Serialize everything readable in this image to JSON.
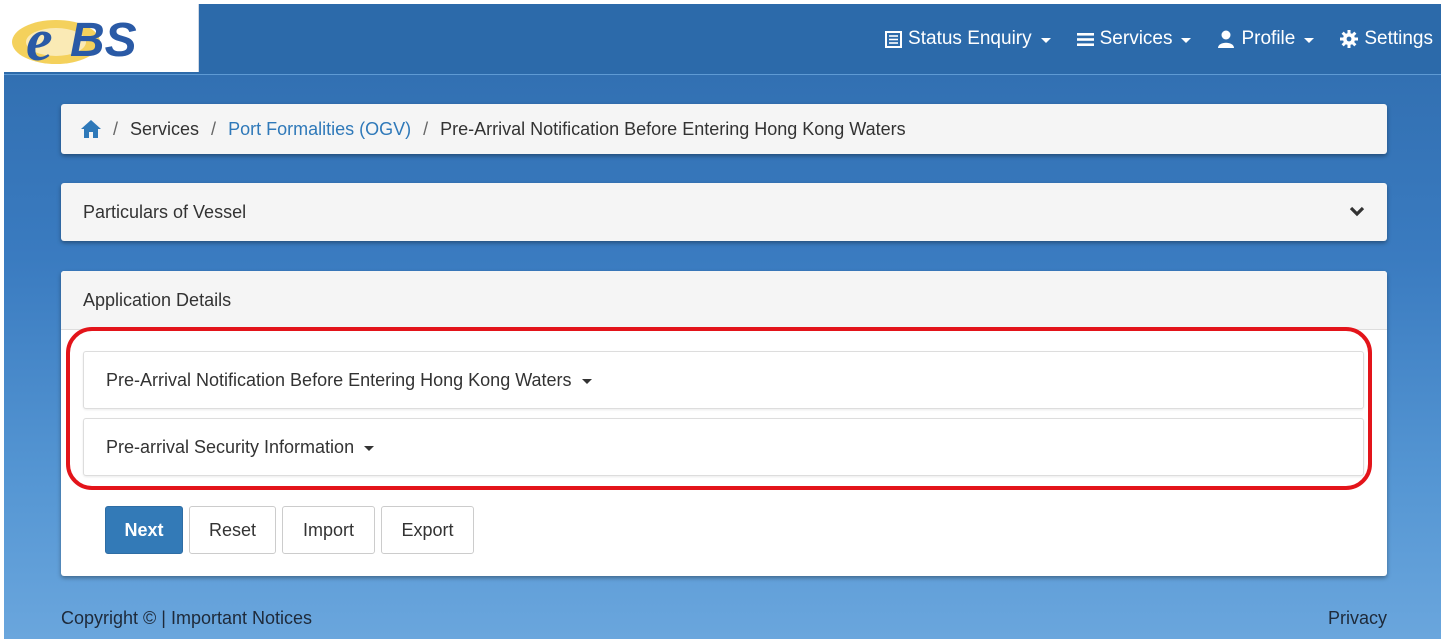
{
  "logo": {
    "text": "eBS"
  },
  "nav": {
    "status_enquiry": "Status Enquiry",
    "services": "Services",
    "profile": "Profile",
    "settings": "Settings"
  },
  "breadcrumb": {
    "services": "Services",
    "port_formalities": "Port Formalities (OGV)",
    "current": "Pre-Arrival Notification Before Entering Hong Kong Waters",
    "separator": "/"
  },
  "particulars": {
    "title": "Particulars of Vessel"
  },
  "application": {
    "title": "Application Details",
    "sections": [
      {
        "label": "Pre-Arrival Notification Before Entering Hong Kong Waters"
      },
      {
        "label": "Pre-arrival Security Information"
      }
    ]
  },
  "buttons": {
    "next": "Next",
    "reset": "Reset",
    "import": "Import",
    "export": "Export"
  },
  "footer": {
    "copyright": "Copyright © | Important Notices",
    "privacy": "Privacy"
  },
  "colors": {
    "accent": "#337ab7",
    "highlight": "#e3141a",
    "navbar": "#2c6aaa"
  }
}
